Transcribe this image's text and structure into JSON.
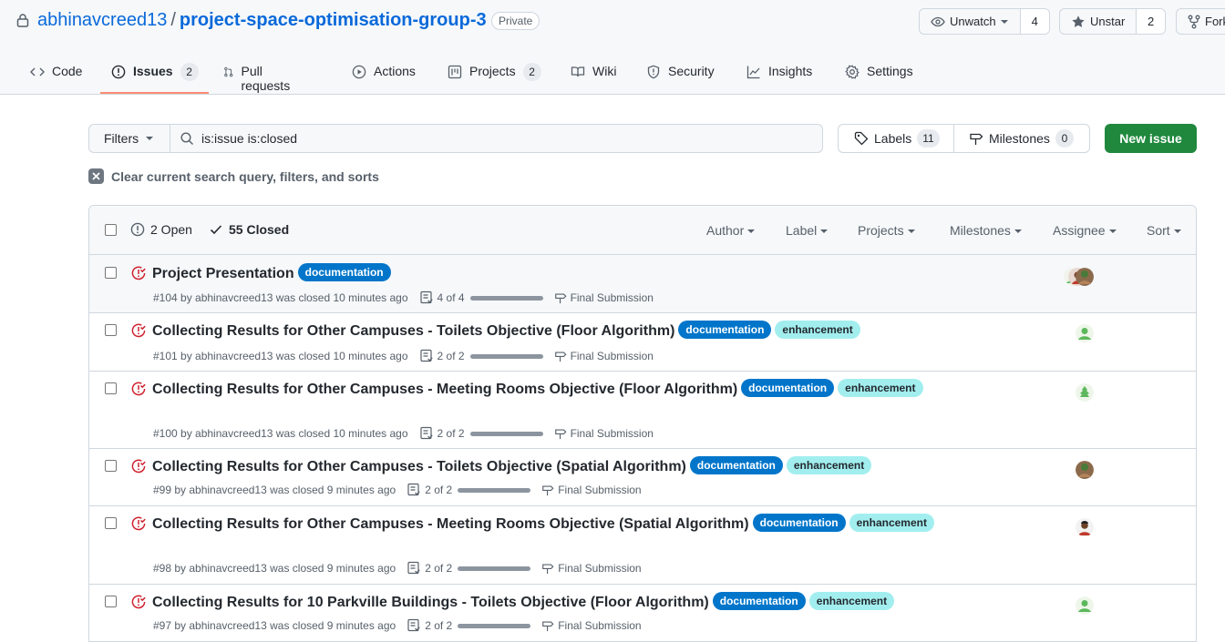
{
  "repo": {
    "owner": "abhinavcreed13",
    "separator": "/",
    "name": "project-space-optimisation-group-3",
    "visibility": "Private"
  },
  "actions": {
    "watch_label": "Unwatch",
    "watch_count": "4",
    "star_label": "Unstar",
    "star_count": "2",
    "fork_label": "Fork"
  },
  "tabs": [
    {
      "label": "Code"
    },
    {
      "label": "Issues",
      "count": "2"
    },
    {
      "label": "Pull requests"
    },
    {
      "label": "Actions"
    },
    {
      "label": "Projects",
      "count": "2"
    },
    {
      "label": "Wiki"
    },
    {
      "label": "Security"
    },
    {
      "label": "Insights"
    },
    {
      "label": "Settings"
    }
  ],
  "toolbar": {
    "filters_label": "Filters",
    "search_value": "is:issue is:closed",
    "labels_label": "Labels",
    "labels_count": "11",
    "milestones_label": "Milestones",
    "milestones_count": "0",
    "new_issue_label": "New issue"
  },
  "clear_label": "Clear current search query, filters, and sorts",
  "list_header": {
    "open_label": "2 Open",
    "closed_label": "55 Closed",
    "filters": [
      "Author",
      "Label",
      "Projects",
      "Milestones",
      "Assignee",
      "Sort"
    ]
  },
  "label_names": {
    "documentation": "documentation",
    "enhancement": "enhancement"
  },
  "issues": [
    {
      "title": "Project Presentation",
      "meta": "#104 by abhinavcreed13 was closed 10 minutes ago",
      "tasks": "4 of 4",
      "tasks_done": 1.0,
      "milestone": "Final Submission"
    },
    {
      "title": "Collecting Results for Other Campuses - Toilets Objective (Floor Algorithm)",
      "meta": "#101 by abhinavcreed13 was closed 10 minutes ago",
      "tasks": "2 of 2",
      "tasks_done": 1.0,
      "milestone": "Final Submission"
    },
    {
      "title": "Collecting Results for Other Campuses - Meeting Rooms Objective (Floor Algorithm)",
      "meta": "#100 by abhinavcreed13 was closed 10 minutes ago",
      "tasks": "2 of 2",
      "tasks_done": 1.0,
      "milestone": "Final Submission"
    },
    {
      "title": "Collecting Results for Other Campuses - Toilets Objective (Spatial Algorithm)",
      "meta": "#99 by abhinavcreed13 was closed 9 minutes ago",
      "tasks": "2 of 2",
      "tasks_done": 1.0,
      "milestone": "Final Submission"
    },
    {
      "title": "Collecting Results for Other Campuses - Meeting Rooms Objective (Spatial Algorithm)",
      "meta": "#98 by abhinavcreed13 was closed 9 minutes ago",
      "tasks": "2 of 2",
      "tasks_done": 1.0,
      "milestone": "Final Submission"
    },
    {
      "title": "Collecting Results for 10 Parkville Buildings - Toilets Objective (Floor Algorithm)",
      "meta": "#97 by abhinavcreed13 was closed 9 minutes ago",
      "tasks": "2 of 2",
      "tasks_done": 1.0,
      "milestone": "Final Submission"
    }
  ],
  "colors": {
    "accent": "#0969da",
    "closed_icon": "#cf222e",
    "new_issue": "#1f883d",
    "tab_underline": "#fd8c73",
    "documentation_label": "#0075ca",
    "enhancement_label": "#a2eeef"
  }
}
